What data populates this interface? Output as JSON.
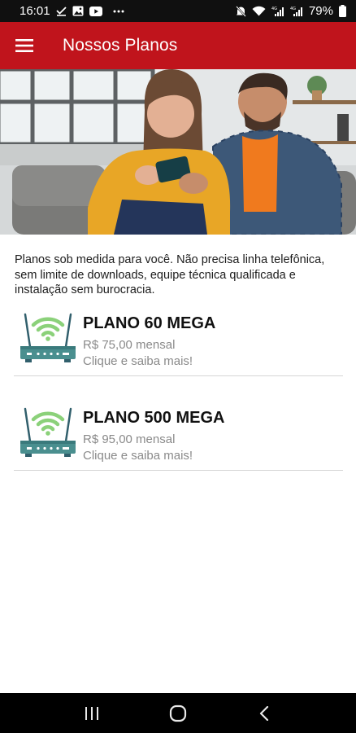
{
  "status_bar": {
    "time": "16:01",
    "battery": "79%",
    "icons_left": [
      "check-download-icon",
      "image-icon",
      "youtube-icon",
      "more-dots-icon"
    ],
    "icons_right": [
      "mute-icon",
      "wifi-icon",
      "signal-4g-icon",
      "signal-lte-icon",
      "battery-icon"
    ]
  },
  "app_bar": {
    "title": "Nossos Planos",
    "color": "#c0141c"
  },
  "intro_text": "Planos sob medida para você. Não precisa linha telefônica, sem limite de downloads, equipe técnica qualificada e instalação sem burocracia.",
  "plans": [
    {
      "name": "PLANO 60 MEGA",
      "price": "R$ 75,00 mensal",
      "cta": "Clique e saiba mais!",
      "icon": "wifi-router-icon"
    },
    {
      "name": "PLANO 500 MEGA",
      "price": "R$ 95,00 mensal",
      "cta": "Clique e saiba mais!",
      "icon": "wifi-router-icon"
    }
  ],
  "nav_bar": [
    "recent-apps-icon",
    "home-icon",
    "back-icon"
  ]
}
